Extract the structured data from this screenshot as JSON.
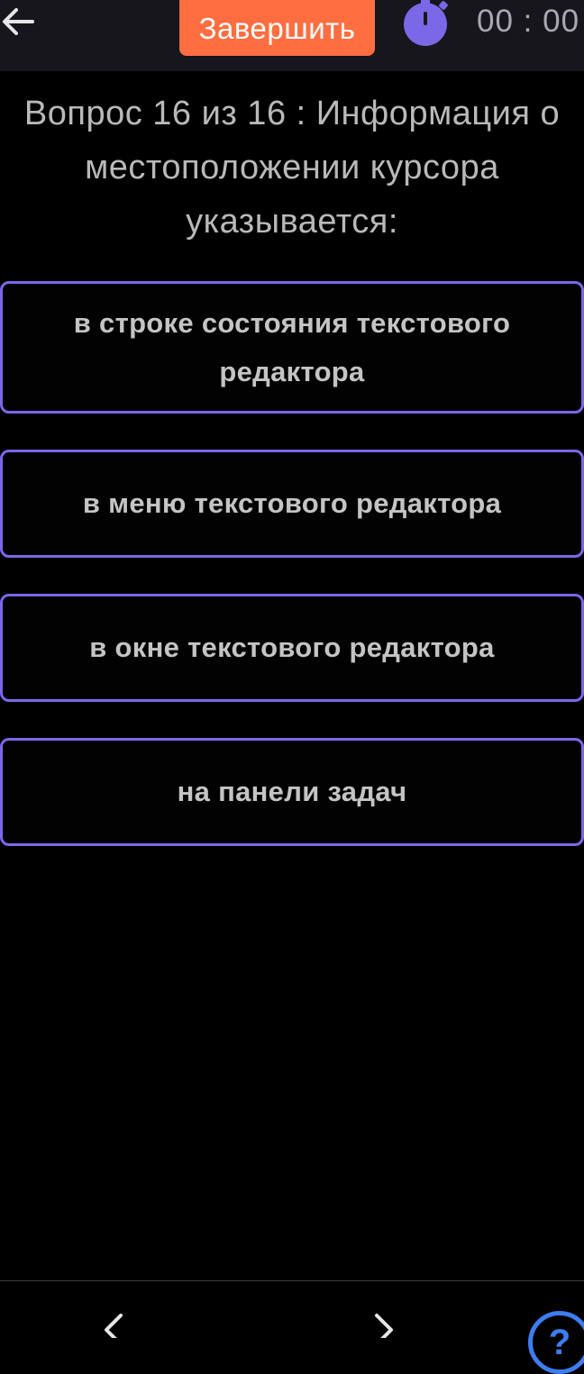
{
  "header": {
    "back_icon": "arrow-left-icon",
    "finish_label": "Завершить",
    "timer_icon": "stopwatch-icon",
    "timer_text": "00 : 00",
    "background_color": "#16161c",
    "finish_color": "#ff6e40",
    "timer_icon_color": "#7b68e6"
  },
  "question": {
    "text": "Вопрос 16 из 16 : Информация о местоположении курсора указывается:"
  },
  "options": [
    {
      "label": "в строке состояния текстового редактора"
    },
    {
      "label": "в меню текстового редактора"
    },
    {
      "label": "в окне текстового редактора"
    },
    {
      "label": "на панели задач"
    }
  ],
  "option_border_color": "#7b68e6",
  "bottom_nav": {
    "prev_icon": "chevron-left-icon",
    "next_icon": "chevron-right-icon",
    "help_icon": "question-mark-icon",
    "help_label": "?",
    "help_color": "#3d7df0"
  }
}
